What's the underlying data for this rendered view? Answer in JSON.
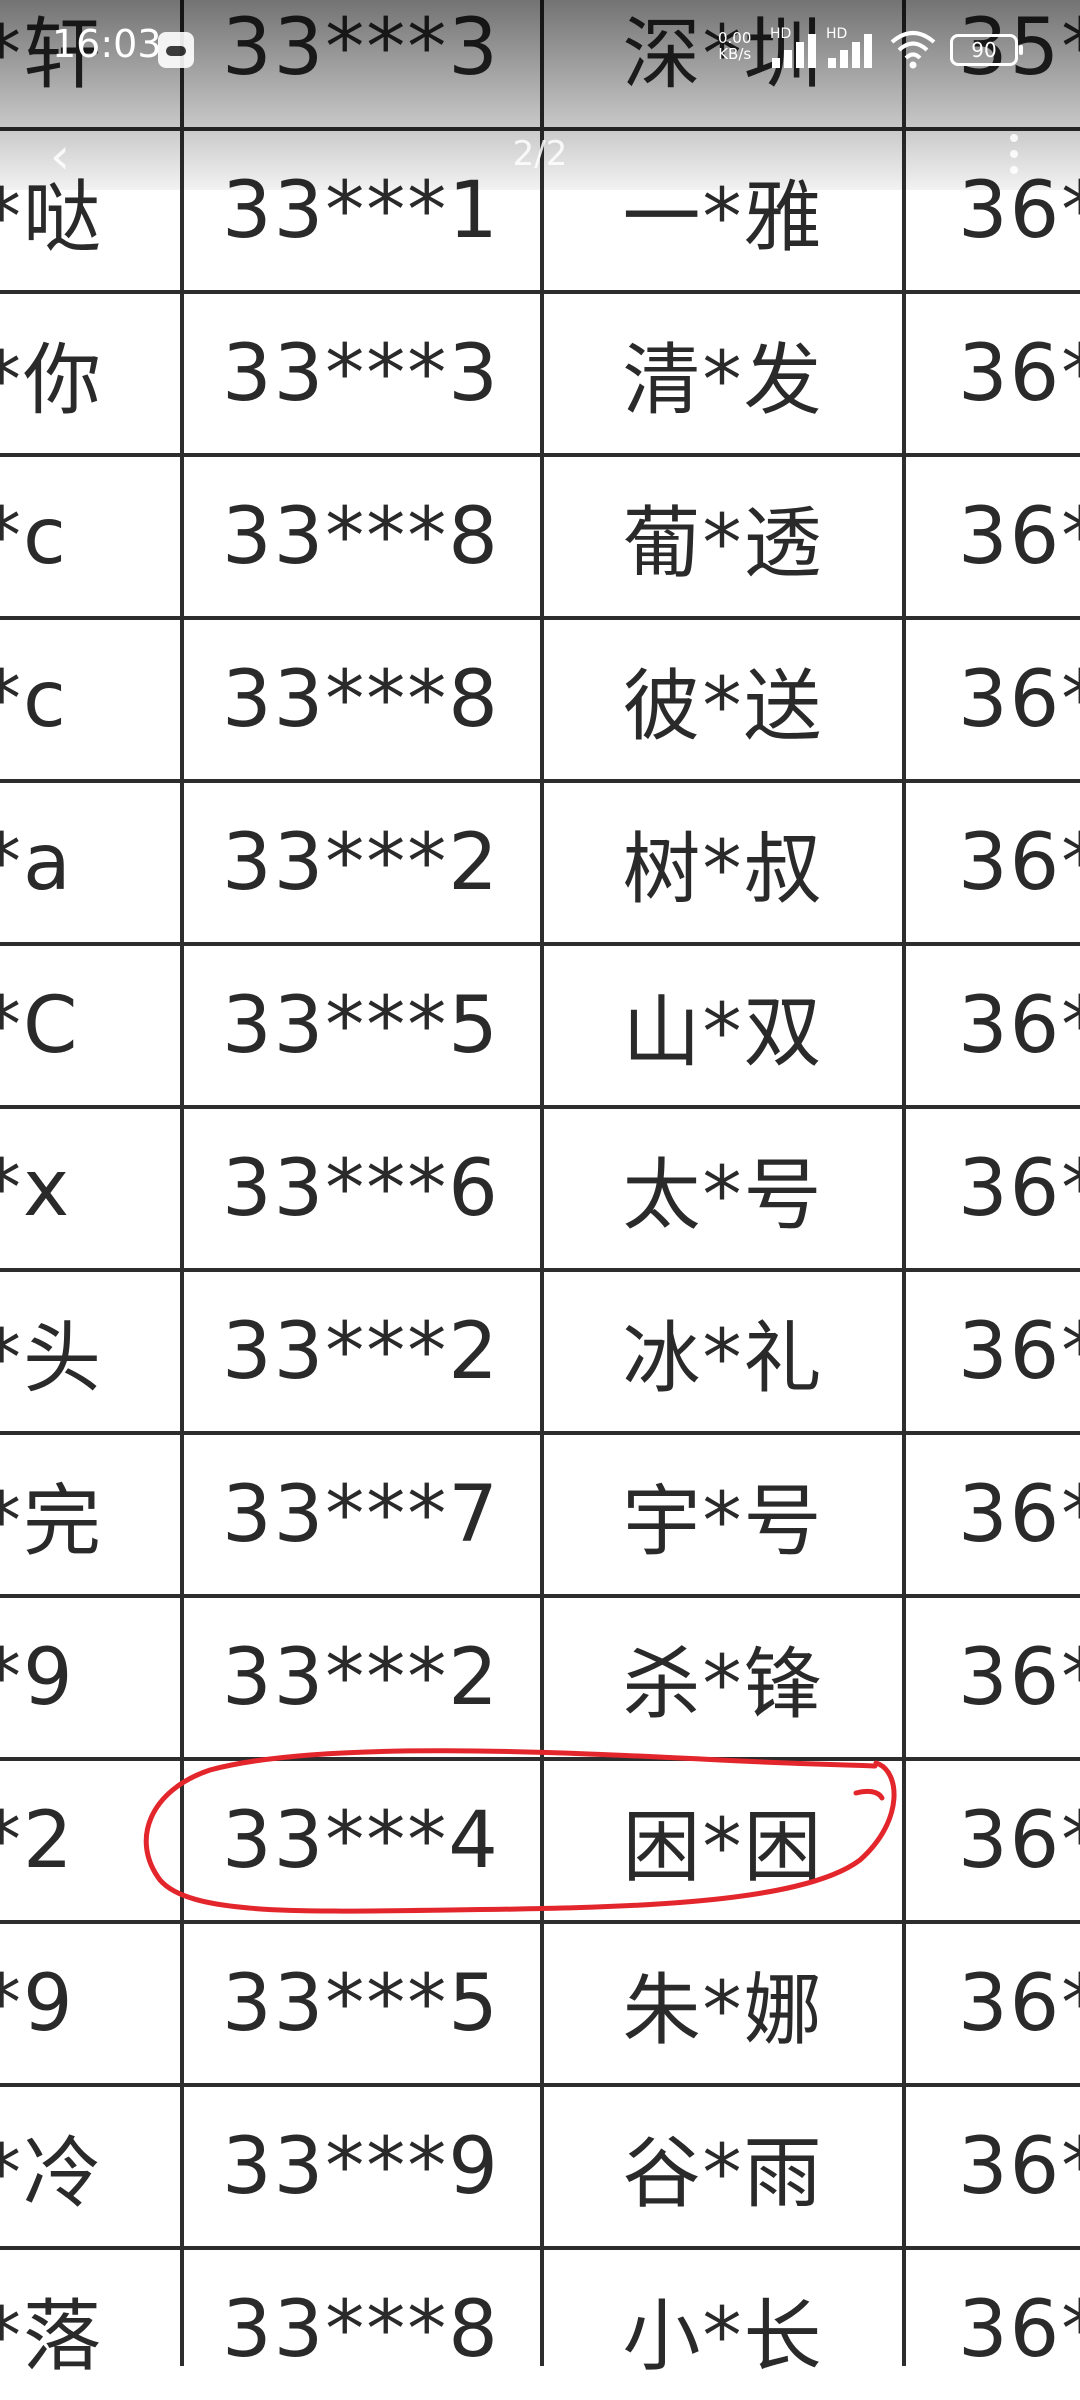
{
  "status_bar": {
    "time": "16:03",
    "net_speed_value": "0.00",
    "net_speed_unit": "KB/s",
    "network_badge_1": "HD",
    "network_badge_2": "HD",
    "battery": "90"
  },
  "viewer": {
    "page_indicator": "2/2"
  },
  "table": {
    "rows": [
      [
        "*轩",
        "33***3",
        "深*圳",
        "35*"
      ],
      [
        "*哒",
        "33***1",
        "一*雅",
        "36*"
      ],
      [
        "*你",
        "33***3",
        "清*发",
        "36*"
      ],
      [
        "*c",
        "33***8",
        "葡*透",
        "36*"
      ],
      [
        "*c",
        "33***8",
        "彼*送",
        "36*"
      ],
      [
        "*a",
        "33***2",
        "树*叔",
        "36*"
      ],
      [
        "*C",
        "33***5",
        "山*双",
        "36*"
      ],
      [
        "*x",
        "33***6",
        "太*号",
        "36*"
      ],
      [
        "*头",
        "33***2",
        "冰*礼",
        "36*"
      ],
      [
        "*完",
        "33***7",
        "宇*号",
        "36*"
      ],
      [
        "*9",
        "33***2",
        "杀*锋",
        "36*"
      ],
      [
        "*2",
        "33***4",
        "困*困",
        "36*"
      ],
      [
        "*9",
        "33***5",
        "朱*娜",
        "36*"
      ],
      [
        "*冷",
        "33***9",
        "谷*雨",
        "36*"
      ],
      [
        "*落",
        "33***8",
        "小*长",
        "36*"
      ]
    ],
    "highlighted_row": 11
  },
  "annotation": {
    "color": "#e3262c"
  }
}
